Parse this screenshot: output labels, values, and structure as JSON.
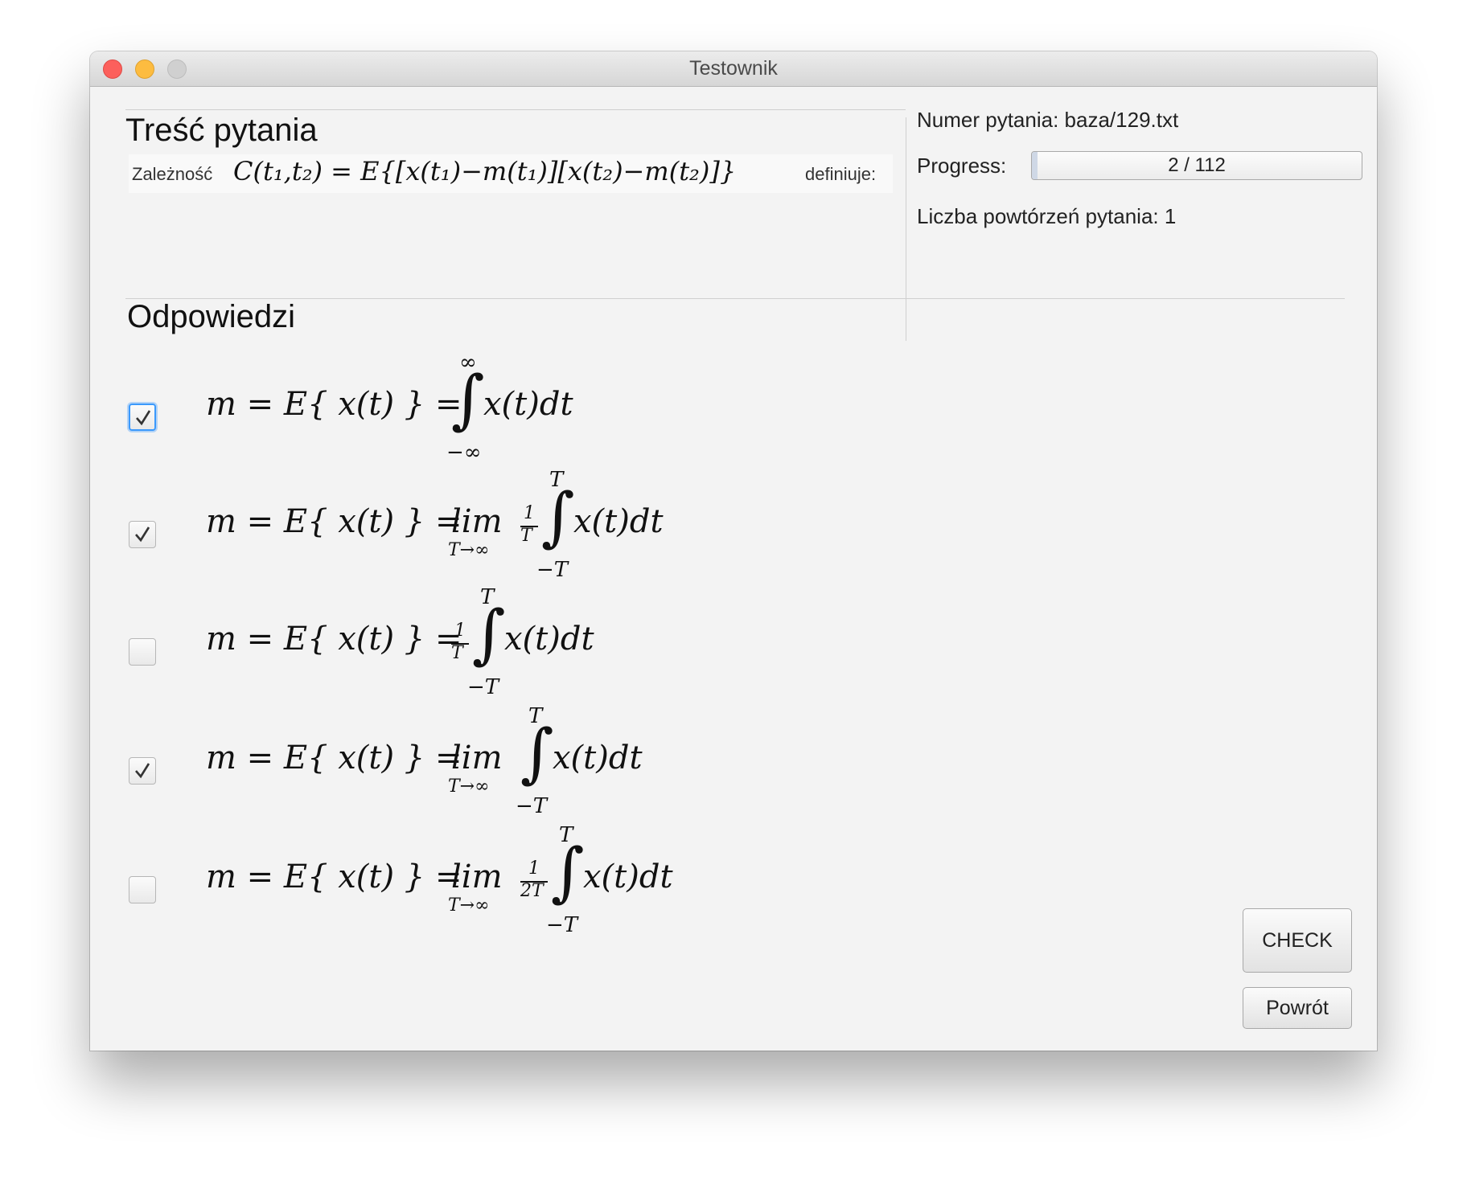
{
  "window": {
    "title": "Testownik"
  },
  "question": {
    "section_title": "Treść pytania",
    "prefix": "Zależność",
    "formula": "C(t₁,t₂) = E{[x(t₁)−m(t₁)][x(t₂)−m(t₂)]}",
    "suffix": "definiuje:"
  },
  "info": {
    "number_label": "Numer pytania:",
    "number_value": "baza/129.txt",
    "progress_label": "Progress:",
    "progress_text": "2 / 112",
    "progress_fraction": 0.018,
    "repeats_label": "Liczba powtórzeń pytania:",
    "repeats_value": "1"
  },
  "answers": {
    "section_title": "Odpowiedzi",
    "items": [
      {
        "checked": true,
        "lhs": "m = E{ x(t) } =",
        "lim": "",
        "lim_sub": "",
        "frac_num": "",
        "frac_den": "",
        "int_upper": "∞",
        "int_lower": "−∞",
        "integrand": "x(t)dt"
      },
      {
        "checked": true,
        "lhs": "m = E{ x(t) } =",
        "lim": "lim",
        "lim_sub": "T→∞",
        "frac_num": "1",
        "frac_den": "T",
        "int_upper": "T",
        "int_lower": "−T",
        "integrand": "x(t)dt"
      },
      {
        "checked": false,
        "lhs": "m = E{ x(t) } =",
        "lim": "",
        "lim_sub": "",
        "frac_num": "1",
        "frac_den": "T",
        "int_upper": "T",
        "int_lower": "−T",
        "integrand": "x(t)dt"
      },
      {
        "checked": true,
        "lhs": "m = E{ x(t) } =",
        "lim": "lim",
        "lim_sub": "T→∞",
        "frac_num": "",
        "frac_den": "",
        "int_upper": "T",
        "int_lower": "−T",
        "integrand": "x(t)dt"
      },
      {
        "checked": false,
        "lhs": "m = E{ x(t) } =",
        "lim": "lim",
        "lim_sub": "T→∞",
        "frac_num": "1",
        "frac_den": "2T",
        "int_upper": "T",
        "int_lower": "−T",
        "integrand": "x(t)dt"
      }
    ]
  },
  "buttons": {
    "check": "CHECK",
    "back": "Powrót"
  },
  "colors": {
    "focus": "#3b99fc",
    "window_bg": "#f3f3f3"
  }
}
